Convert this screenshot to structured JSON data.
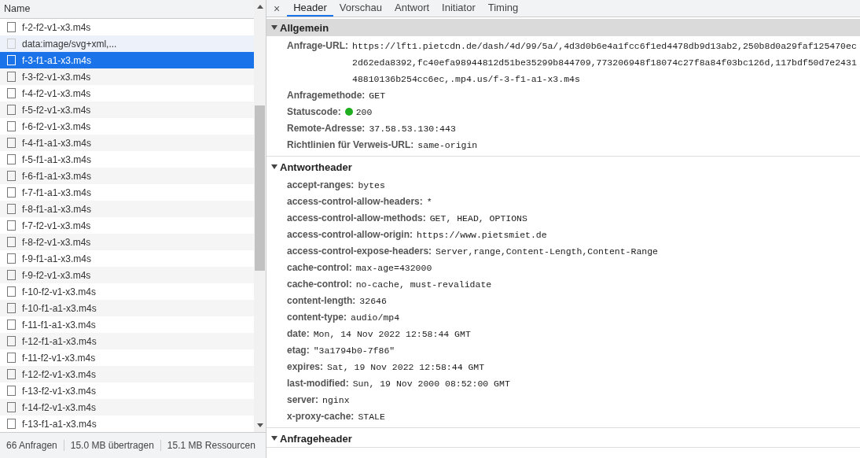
{
  "requests": {
    "column": "Name",
    "rows": [
      {
        "name": "f-2-f2-v1-x3.m4s",
        "kind": "file",
        "selected": false
      },
      {
        "name": "data:image/svg+xml,...",
        "kind": "data",
        "selected": false
      },
      {
        "name": "f-3-f1-a1-x3.m4s",
        "kind": "file",
        "selected": true
      },
      {
        "name": "f-3-f2-v1-x3.m4s",
        "kind": "file",
        "selected": false
      },
      {
        "name": "f-4-f2-v1-x3.m4s",
        "kind": "file",
        "selected": false
      },
      {
        "name": "f-5-f2-v1-x3.m4s",
        "kind": "file",
        "selected": false
      },
      {
        "name": "f-6-f2-v1-x3.m4s",
        "kind": "file",
        "selected": false
      },
      {
        "name": "f-4-f1-a1-x3.m4s",
        "kind": "file",
        "selected": false
      },
      {
        "name": "f-5-f1-a1-x3.m4s",
        "kind": "file",
        "selected": false
      },
      {
        "name": "f-6-f1-a1-x3.m4s",
        "kind": "file",
        "selected": false
      },
      {
        "name": "f-7-f1-a1-x3.m4s",
        "kind": "file",
        "selected": false
      },
      {
        "name": "f-8-f1-a1-x3.m4s",
        "kind": "file",
        "selected": false
      },
      {
        "name": "f-7-f2-v1-x3.m4s",
        "kind": "file",
        "selected": false
      },
      {
        "name": "f-8-f2-v1-x3.m4s",
        "kind": "file",
        "selected": false
      },
      {
        "name": "f-9-f1-a1-x3.m4s",
        "kind": "file",
        "selected": false
      },
      {
        "name": "f-9-f2-v1-x3.m4s",
        "kind": "file",
        "selected": false
      },
      {
        "name": "f-10-f2-v1-x3.m4s",
        "kind": "file",
        "selected": false
      },
      {
        "name": "f-10-f1-a1-x3.m4s",
        "kind": "file",
        "selected": false
      },
      {
        "name": "f-11-f1-a1-x3.m4s",
        "kind": "file",
        "selected": false
      },
      {
        "name": "f-12-f1-a1-x3.m4s",
        "kind": "file",
        "selected": false
      },
      {
        "name": "f-11-f2-v1-x3.m4s",
        "kind": "file",
        "selected": false
      },
      {
        "name": "f-12-f2-v1-x3.m4s",
        "kind": "file",
        "selected": false
      },
      {
        "name": "f-13-f2-v1-x3.m4s",
        "kind": "file",
        "selected": false
      },
      {
        "name": "f-14-f2-v1-x3.m4s",
        "kind": "file",
        "selected": false
      },
      {
        "name": "f-13-f1-a1-x3.m4s",
        "kind": "file",
        "selected": false
      }
    ]
  },
  "status_bar": [
    "66 Anfragen",
    "15.0 MB übertragen",
    "15.1 MB Ressourcen"
  ],
  "tabs": [
    {
      "label": "Header",
      "selected": true
    },
    {
      "label": "Vorschau",
      "selected": false
    },
    {
      "label": "Antwort",
      "selected": false
    },
    {
      "label": "Initiator",
      "selected": false
    },
    {
      "label": "Timing",
      "selected": false
    }
  ],
  "close": "×",
  "sections": [
    {
      "title": "Allgemein",
      "expanded": true,
      "highlighted": true,
      "rows": [
        {
          "key": "Anfrage-URL:",
          "value": "https://lft1.pietcdn.de/dash/4d/99/5a/,4d3d0b6e4a1fcc6f1ed4478db9d13ab2,250b8d0a29faf125470ec2d62eda8392,fc40efa98944812d51be35299b844709,773206948f18074c27f8a84f03bc126d,117bdf50d7e243148810136b254cc6ec,.mp4.us/f-3-f1-a1-x3.m4s"
        },
        {
          "key": "Anfragemethode:",
          "value": "GET"
        },
        {
          "key": "Statuscode:",
          "value": "200",
          "color": "#1fae1f"
        },
        {
          "key": "Remote-Adresse:",
          "value": "37.58.53.130:443"
        },
        {
          "key": "Richtlinien für Verweis-URL:",
          "value": "same-origin"
        }
      ]
    },
    {
      "title": "Antwortheader",
      "expanded": true,
      "highlighted": false,
      "rows": [
        {
          "key": "accept-ranges:",
          "value": "bytes"
        },
        {
          "key": "access-control-allow-headers:",
          "value": "*"
        },
        {
          "key": "access-control-allow-methods:",
          "value": "GET, HEAD, OPTIONS"
        },
        {
          "key": "access-control-allow-origin:",
          "value": "https://www.pietsmiet.de"
        },
        {
          "key": "access-control-expose-headers:",
          "value": "Server,range,Content-Length,Content-Range"
        },
        {
          "key": "cache-control:",
          "value": "max-age=432000"
        },
        {
          "key": "cache-control:",
          "value": "no-cache, must-revalidate"
        },
        {
          "key": "content-length:",
          "value": "32646"
        },
        {
          "key": "content-type:",
          "value": "audio/mp4"
        },
        {
          "key": "date:",
          "value": "Mon, 14 Nov 2022 12:58:44 GMT"
        },
        {
          "key": "etag:",
          "value": "\"3a1794b0-7f86\""
        },
        {
          "key": "expires:",
          "value": "Sat, 19 Nov 2022 12:58:44 GMT"
        },
        {
          "key": "last-modified:",
          "value": "Sun, 19 Nov 2000 08:52:00 GMT"
        },
        {
          "key": "server:",
          "value": "nginx"
        },
        {
          "key": "x-proxy-cache:",
          "value": "STALE"
        }
      ]
    },
    {
      "title": "Anfrageheader",
      "expanded": true,
      "highlighted": false
    }
  ]
}
